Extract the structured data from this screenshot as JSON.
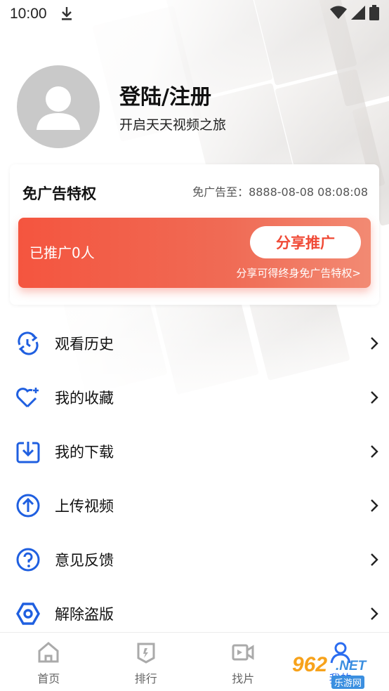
{
  "status_bar": {
    "time": "10:00"
  },
  "profile": {
    "title": "登陆/注册",
    "subtitle": "开启天天视频之旅"
  },
  "ad_card": {
    "title": "免广告特权",
    "until": "免广告至：8888-08-08 08:08:08",
    "promo_count": "已推广0人",
    "share_button": "分享推广",
    "share_note": "分享可得终身免广告特权>"
  },
  "menu": [
    {
      "label": "观看历史",
      "icon": "history-icon"
    },
    {
      "label": "我的收藏",
      "icon": "heart-plus-icon"
    },
    {
      "label": "我的下载",
      "icon": "download-icon"
    },
    {
      "label": "上传视频",
      "icon": "upload-icon"
    },
    {
      "label": "意见反馈",
      "icon": "question-icon"
    },
    {
      "label": "解除盗版",
      "icon": "hexagon-icon"
    }
  ],
  "bottom_nav": [
    {
      "label": "首页",
      "icon": "home-icon"
    },
    {
      "label": "排行",
      "icon": "ranking-icon"
    },
    {
      "label": "找片",
      "icon": "video-camera-icon"
    },
    {
      "label": "我的",
      "icon": "user-icon",
      "active": true
    }
  ],
  "watermark": {
    "number": "962",
    "net": ".NET",
    "site": "乐游网"
  },
  "colors": {
    "accent_blue": "#2a6cf0",
    "promo_red": "#f4553f",
    "icon_blue": "#1f5fe0"
  }
}
